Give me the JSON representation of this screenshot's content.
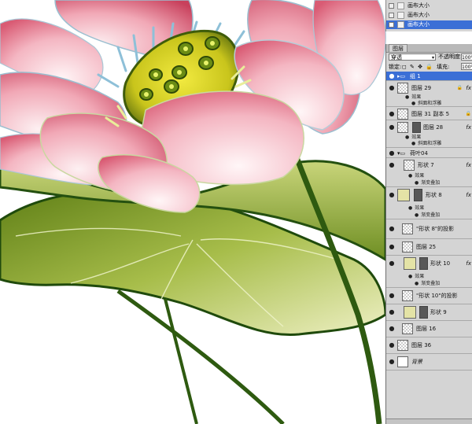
{
  "colors": {
    "petal_pink": "#e8758c",
    "petal_light": "#fbe4ea",
    "petal_deep": "#c0354f",
    "pod_yellow": "#d7d425",
    "pod_green": "#6f8a12",
    "leaf_green": "#7a9a2a",
    "leaf_light": "#eef0c4",
    "leaf_dark": "#2e5a10",
    "panel_bg": "#d4d4d4",
    "selection_blue": "#3b6fd6"
  },
  "history": {
    "items": [
      {
        "label": "画布大小",
        "selected": false
      },
      {
        "label": "画布大小",
        "selected": false
      },
      {
        "label": "画布大小",
        "selected": true
      }
    ]
  },
  "layers_panel": {
    "tab_label": "图层",
    "blend_mode": "穿透",
    "opacity_label": "不透明度:",
    "opacity_value": "100%",
    "lock_label": "锁定:",
    "lock_icons": "◻ ✎ ✥ 🔒",
    "fill_label": "填充:",
    "fill_value": "100%",
    "layers": [
      {
        "name": "组 1",
        "selected": true,
        "kind": "group"
      },
      {
        "name": "图层 29",
        "fx": "fx",
        "effects": [
          "效果",
          "斜面和浮雕"
        ]
      },
      {
        "name": "图层 31 副本 5"
      },
      {
        "name": "图层 28",
        "fx": "fx",
        "mask": true,
        "effects": [
          "效果",
          "斜面和浮雕"
        ]
      },
      {
        "name": "荷叶04",
        "kind": "group"
      },
      {
        "name": "形状 7",
        "fx": "fx",
        "effects": [
          "效果",
          "渐变叠加"
        ]
      },
      {
        "name": "形状 8",
        "fx": "fx",
        "mask": true,
        "swatch": true,
        "effects": [
          "效果",
          "渐变叠加"
        ]
      },
      {
        "name": "\"形状 8\"的投影"
      },
      {
        "name": "图层 25"
      },
      {
        "name": "形状 10",
        "fx": "fx",
        "mask": true,
        "swatch": true,
        "effects": [
          "效果",
          "渐变叠加"
        ]
      },
      {
        "name": "\"形状 10\"的投影"
      },
      {
        "name": "形状 9",
        "mask": true,
        "swatch": true
      },
      {
        "name": "图层 16"
      },
      {
        "name": "图层 36"
      },
      {
        "name": "背景"
      }
    ]
  }
}
